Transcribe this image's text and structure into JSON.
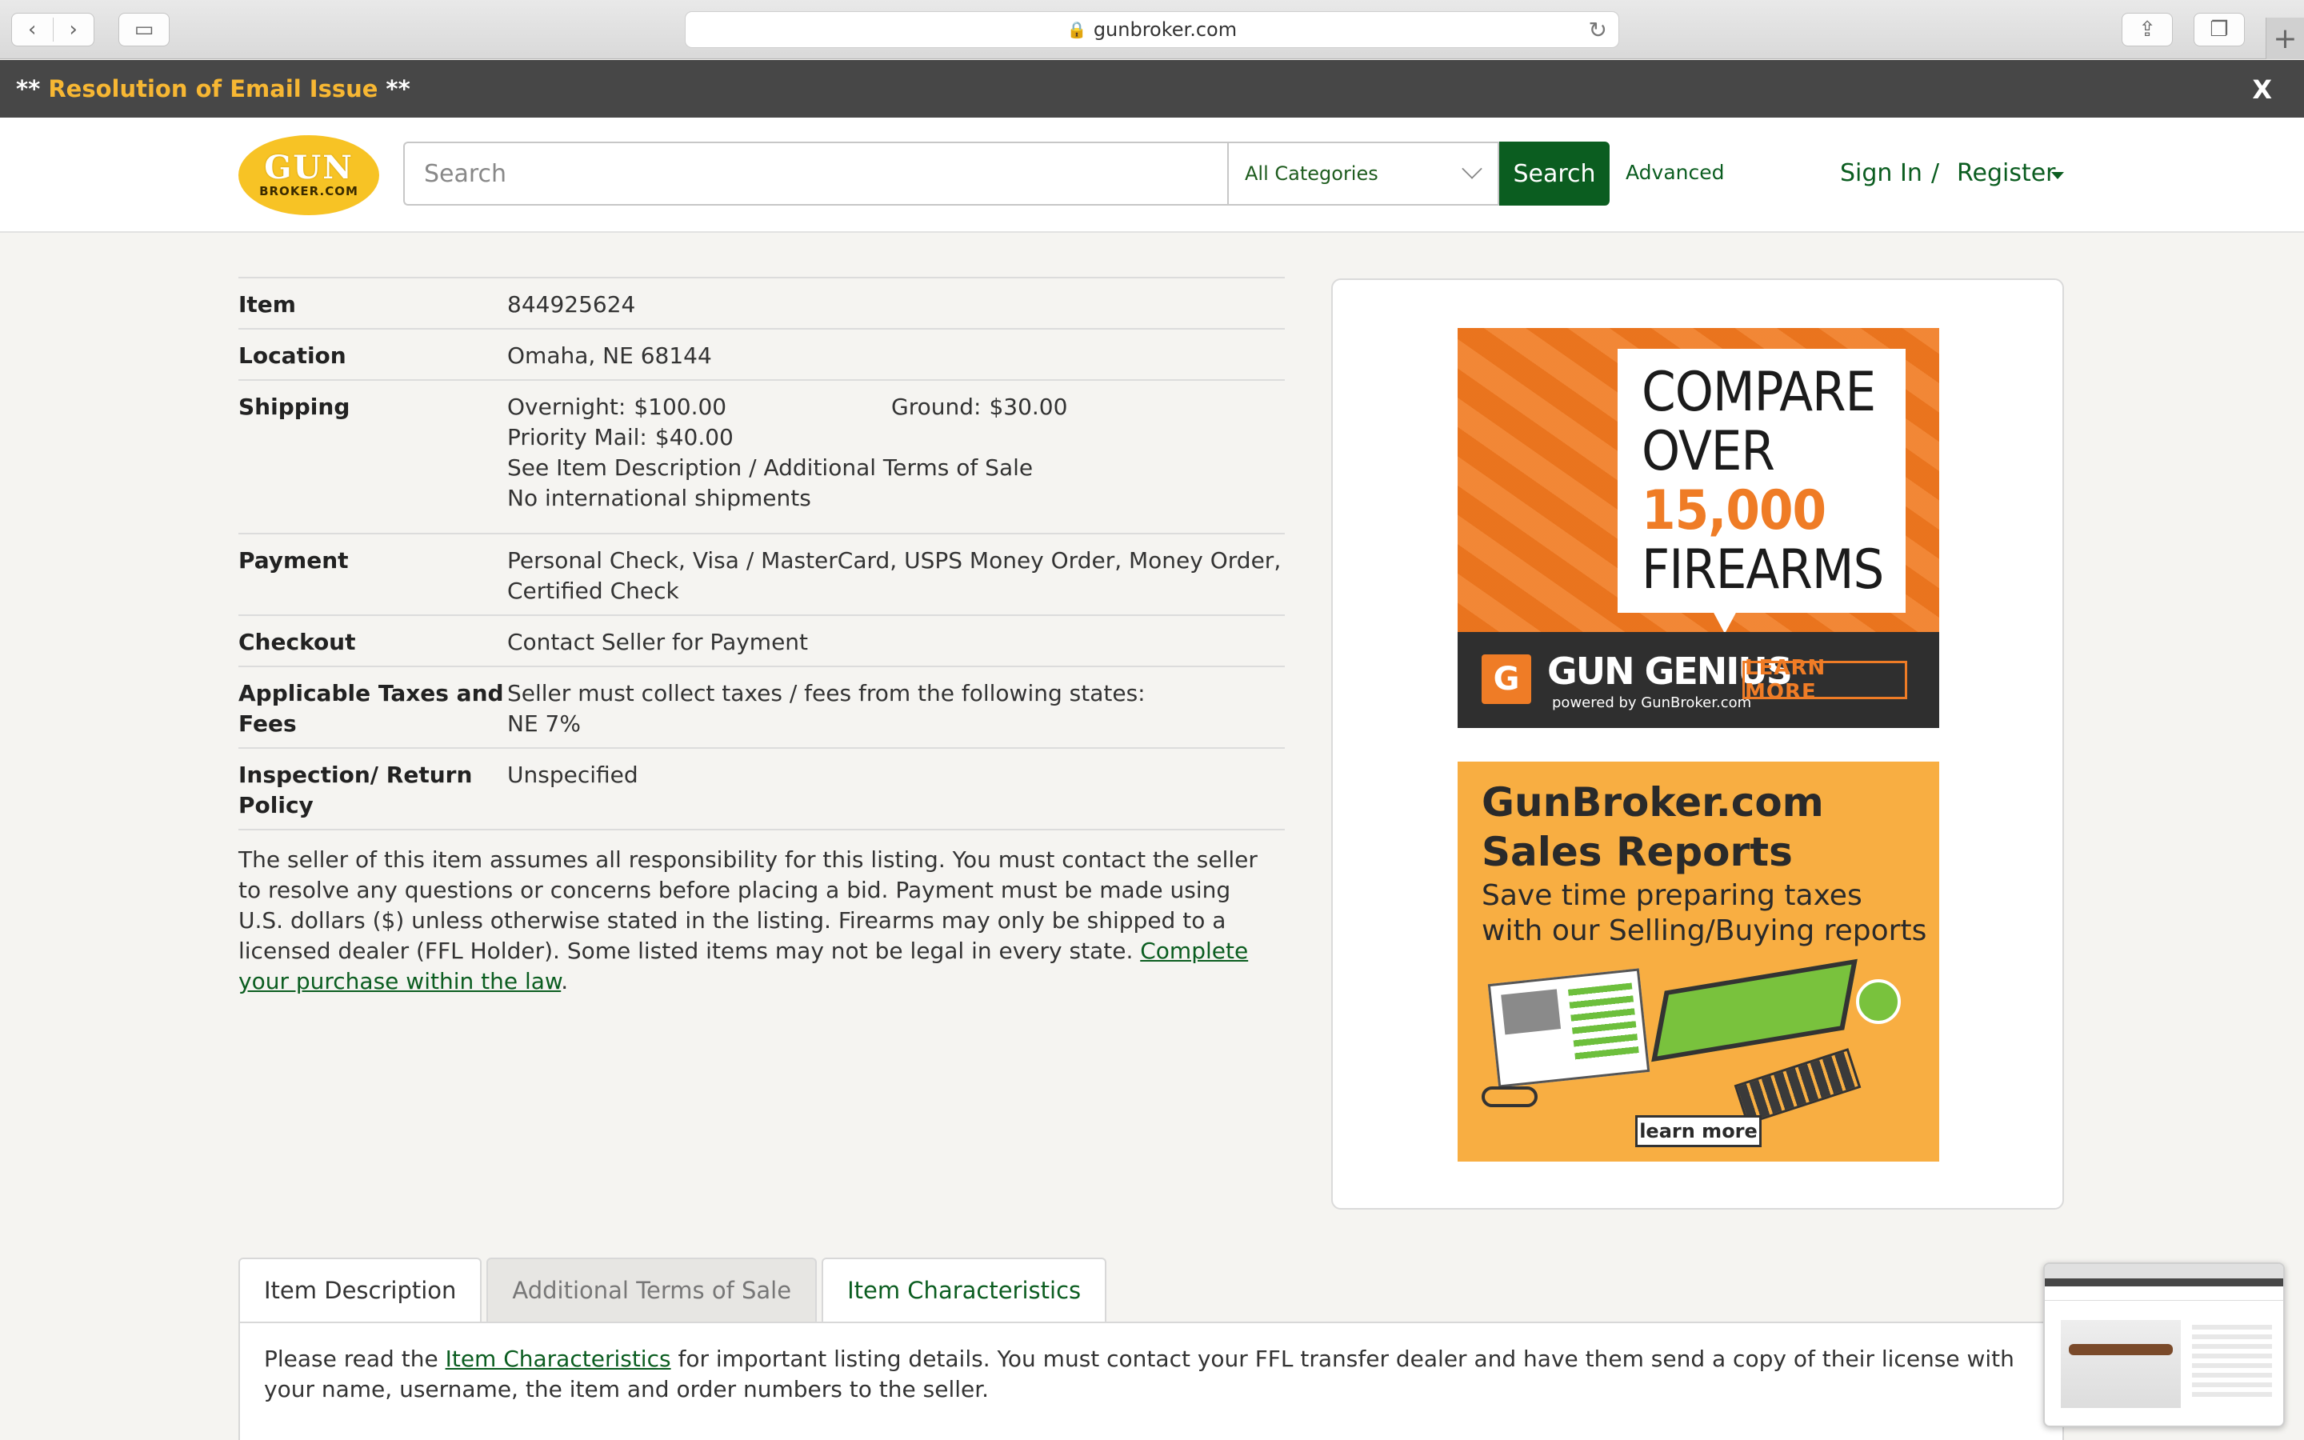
{
  "browser": {
    "url": "gunbroker.com"
  },
  "alert": {
    "prefix": "**",
    "link_text": "Resolution of Email Issue",
    "suffix": "**",
    "close_label": "X"
  },
  "header": {
    "logo_line1": "GUN",
    "logo_line2": "BROKER.COM",
    "search_placeholder": "Search",
    "category_selected": "All Categories",
    "search_button": "Search",
    "advanced_link": "Advanced",
    "sign_in": "Sign In",
    "separator": "/",
    "register": "Register"
  },
  "details": {
    "item": {
      "label": "Item",
      "value": "844925624"
    },
    "location": {
      "label": "Location",
      "value": "Omaha, NE 68144"
    },
    "shipping": {
      "label": "Shipping",
      "overnight_label": "Overnight:",
      "overnight_value": "$100.00",
      "ground_label": "Ground:",
      "ground_value": "$30.00",
      "priority_label": "Priority Mail:",
      "priority_value": "$40.00",
      "note1": "See Item Description / Additional Terms of Sale",
      "note2": "No international shipments"
    },
    "payment": {
      "label": "Payment",
      "value": "Personal Check, Visa / MasterCard, USPS Money Order, Money Order, Certified Check"
    },
    "checkout": {
      "label": "Checkout",
      "value": "Contact Seller for Payment"
    },
    "taxes": {
      "label": "Applicable Taxes and Fees",
      "line1": "Seller must collect taxes / fees from the following states:",
      "line2": "NE 7%"
    },
    "inspection": {
      "label": "Inspection/ Return Policy",
      "value": "Unspecified"
    }
  },
  "disclaimer": {
    "text": "The seller of this item assumes all responsibility for this listing. You must contact the seller to resolve any questions or concerns before placing a bid. Payment must be made using U.S. dollars ($) unless otherwise stated in the listing. Firearms may only be shipped to a licensed dealer (FFL Holder). Some listed items may not be legal in every state. ",
    "link": "Complete your purchase within the law",
    "end": "."
  },
  "ads": {
    "ad1": {
      "line1": "COMPARE",
      "line2": "OVER",
      "line3": "15,000",
      "line4": "FIREARMS",
      "brand": "GUN GENIUS",
      "brand_sub": "powered by GunBroker.com",
      "cta": "LEARN MORE"
    },
    "ad2": {
      "title1": "GunBroker.com",
      "title2": "Sales Reports",
      "sub1": "Save time preparing taxes",
      "sub2": "with our Selling/Buying reports",
      "cta": "learn more"
    }
  },
  "tabs": {
    "items": [
      "Item Description",
      "Additional Terms of Sale",
      "Item Characteristics"
    ],
    "content_prefix": "Please read the ",
    "content_link": "Item Characteristics",
    "content_rest": " for important listing details. You must contact your FFL transfer dealer and have them send a copy of their license with your name, username, the item and order numbers to the seller."
  },
  "colors": {
    "brand_green": "#0b5d20",
    "alert_bg": "#474747",
    "alert_link": "#f7b733",
    "logo_yellow": "#f7c325"
  }
}
